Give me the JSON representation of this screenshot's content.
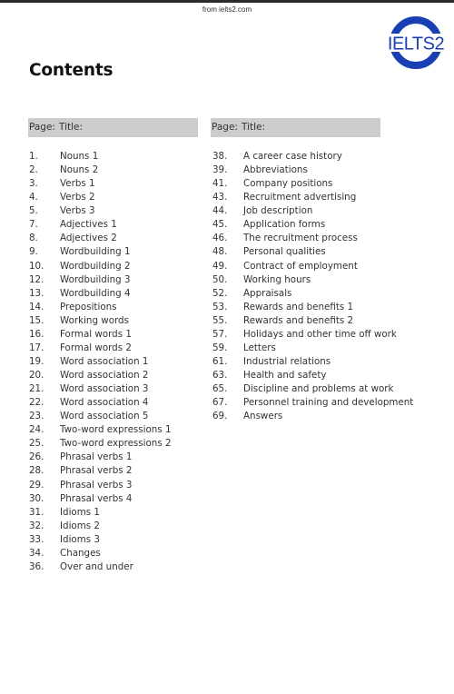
{
  "source_text": "from ielts2.com",
  "logo": {
    "text": "IELTS2",
    "color": "#1a3fb5"
  },
  "page_title": "Contents",
  "table_header": {
    "page_label": "Page:",
    "title_label": "Title:"
  },
  "left_column": [
    {
      "page": "1.",
      "title": "Nouns 1"
    },
    {
      "page": "2.",
      "title": "Nouns 2"
    },
    {
      "page": "3.",
      "title": "Verbs 1"
    },
    {
      "page": "4.",
      "title": "Verbs 2"
    },
    {
      "page": "5.",
      "title": "Verbs 3"
    },
    {
      "page": "7.",
      "title": "Adjectives 1"
    },
    {
      "page": "8.",
      "title": "Adjectives 2"
    },
    {
      "page": "9.",
      "title": "Wordbuilding 1"
    },
    {
      "page": "10.",
      "title": "Wordbuilding 2"
    },
    {
      "page": "12.",
      "title": "Wordbuilding 3"
    },
    {
      "page": "13.",
      "title": "Wordbuilding 4"
    },
    {
      "page": "14.",
      "title": "Prepositions"
    },
    {
      "page": "15.",
      "title": "Working words"
    },
    {
      "page": "16.",
      "title": "Formal words 1"
    },
    {
      "page": "17.",
      "title": "Formal words 2"
    },
    {
      "page": "19.",
      "title": "Word association 1"
    },
    {
      "page": "20.",
      "title": "Word association 2"
    },
    {
      "page": "21.",
      "title": "Word association 3"
    },
    {
      "page": "22.",
      "title": "Word association 4"
    },
    {
      "page": "23.",
      "title": "Word association 5"
    },
    {
      "page": "24.",
      "title": "Two-word expressions 1"
    },
    {
      "page": "25.",
      "title": "Two-word expressions 2"
    },
    {
      "page": "26.",
      "title": "Phrasal verbs 1"
    },
    {
      "page": "28.",
      "title": "Phrasal verbs 2"
    },
    {
      "page": "29.",
      "title": "Phrasal verbs 3"
    },
    {
      "page": "30.",
      "title": "Phrasal verbs 4"
    },
    {
      "page": "31.",
      "title": "Idioms 1"
    },
    {
      "page": "32.",
      "title": "Idioms 2"
    },
    {
      "page": "33.",
      "title": "Idioms 3"
    },
    {
      "page": "34.",
      "title": "Changes"
    },
    {
      "page": "36.",
      "title": "Over and under"
    }
  ],
  "right_column": [
    {
      "page": "38.",
      "title": "A career case history"
    },
    {
      "page": "39.",
      "title": "Abbreviations"
    },
    {
      "page": "41.",
      "title": "Company positions"
    },
    {
      "page": "43.",
      "title": "Recruitment advertising"
    },
    {
      "page": "44.",
      "title": "Job description"
    },
    {
      "page": "45.",
      "title": "Application forms"
    },
    {
      "page": "46.",
      "title": "The recruitment process"
    },
    {
      "page": "48.",
      "title": "Personal qualities"
    },
    {
      "page": "49.",
      "title": "Contract of employment"
    },
    {
      "page": "50.",
      "title": "Working hours"
    },
    {
      "page": "52.",
      "title": "Appraisals"
    },
    {
      "page": "53.",
      "title": "Rewards and benefits 1"
    },
    {
      "page": "55.",
      "title": "Rewards and benefits 2"
    },
    {
      "page": "57.",
      "title": "Holidays and other time off work"
    },
    {
      "page": "59.",
      "title": "Letters"
    },
    {
      "page": "61.",
      "title": "Industrial relations"
    },
    {
      "page": "63.",
      "title": "Health and safety"
    },
    {
      "page": "65.",
      "title": "Discipline and problems at work"
    },
    {
      "page": "67.",
      "title": "Personnel training and development"
    },
    {
      "page": "69.",
      "title": "Answers"
    }
  ]
}
